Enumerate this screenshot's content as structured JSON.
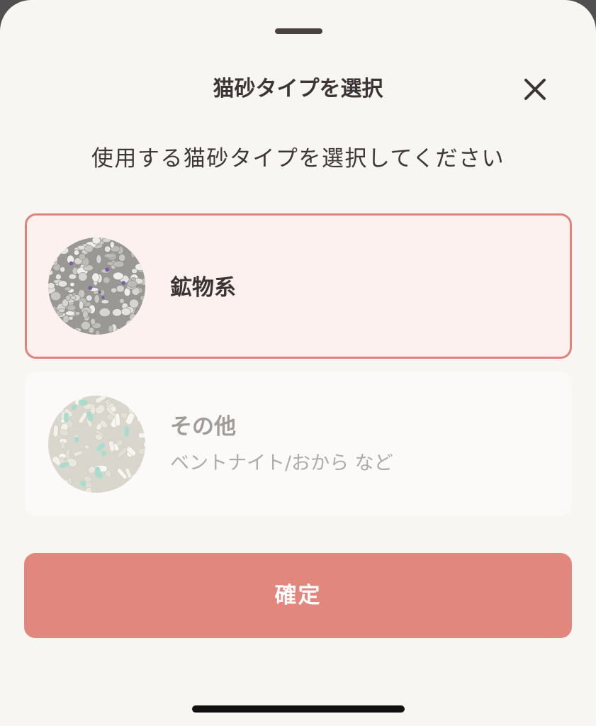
{
  "sheet": {
    "title": "猫砂タイプを選択",
    "close_icon": "close-icon",
    "instruction": "使用する猫砂タイプを選択してください"
  },
  "options": [
    {
      "label": "鉱物系",
      "selected": true,
      "thumbnail_icon": "mineral-litter-thumbnail"
    },
    {
      "label": "その他",
      "sublabel": "ベントナイト/おから など",
      "selected": false,
      "thumbnail_icon": "other-litter-thumbnail"
    }
  ],
  "confirm_label": "確定",
  "colors": {
    "accent": "#e1877e",
    "selected_border": "#dc847b",
    "selected_background": "#fdf1ef",
    "sheet_background": "#f8f6f3",
    "title_text": "#3d3535",
    "muted_text": "#a19c9a"
  }
}
